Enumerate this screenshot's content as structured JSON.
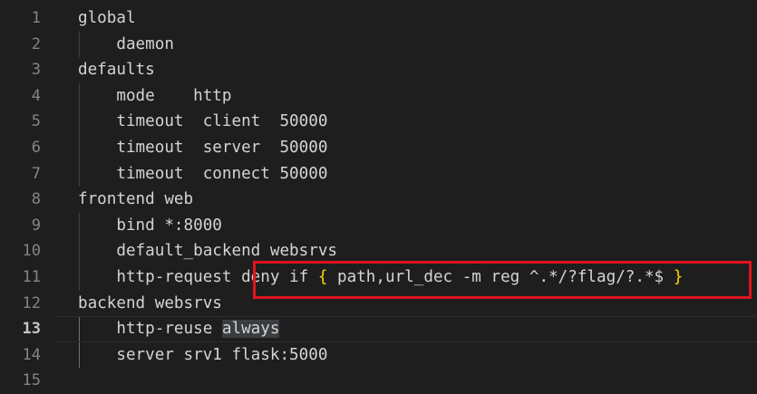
{
  "editor": {
    "lines": [
      {
        "number": "1",
        "indent": "",
        "text": "global"
      },
      {
        "number": "2",
        "indent": "    ",
        "text": "daemon"
      },
      {
        "number": "3",
        "indent": "",
        "text": "defaults"
      },
      {
        "number": "4",
        "indent": "    ",
        "text": "mode    http"
      },
      {
        "number": "5",
        "indent": "    ",
        "text": "timeout  client  50000"
      },
      {
        "number": "6",
        "indent": "    ",
        "text": "timeout  server  50000"
      },
      {
        "number": "7",
        "indent": "    ",
        "text": "timeout  connect 50000"
      },
      {
        "number": "8",
        "indent": "",
        "text": "frontend web"
      },
      {
        "number": "9",
        "indent": "    ",
        "text": "bind *:8000"
      },
      {
        "number": "10",
        "indent": "    ",
        "text": "default_backend websrvs"
      },
      {
        "number": "11",
        "indent": "    ",
        "prefix": "http-request deny if ",
        "brace_open": "{",
        "middle": " path,url_dec -m reg ^.*/?flag/?.*$ ",
        "brace_close": "}"
      },
      {
        "number": "12",
        "indent": "",
        "text": "backend websrvs"
      },
      {
        "number": "13",
        "indent": "    ",
        "prefix": "http-reuse ",
        "highlight": "always"
      },
      {
        "number": "14",
        "indent": "    ",
        "text": "server srv1 flask:5000"
      },
      {
        "number": "15",
        "indent": "",
        "text": ""
      }
    ],
    "active_line": "13"
  },
  "colors": {
    "background": "#1e1e1e",
    "text": "#d4d4d4",
    "line_number": "#858585",
    "active_line_number": "#c6c6c6",
    "brace": "#ffd700",
    "annotation": "#e0141e"
  }
}
